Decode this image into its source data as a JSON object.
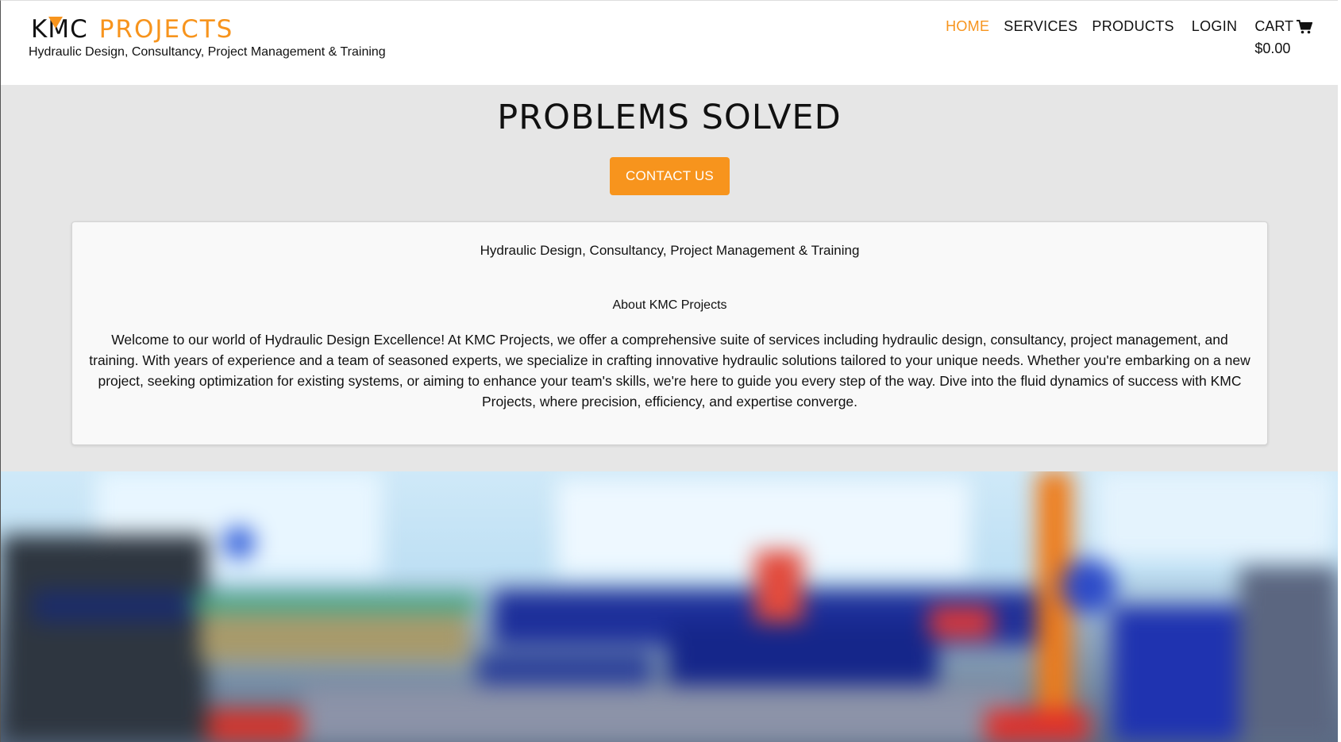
{
  "header": {
    "logo_kmc": "KMC",
    "logo_projects": "PROJECTS",
    "tagline": "Hydraulic Design, Consultancy, Project Management & Training",
    "nav": {
      "home": "HOME",
      "services": "SERVICES",
      "products": "PRODUCTS",
      "login": "LOGIN",
      "cart": "CART",
      "cart_total": "$0.00"
    }
  },
  "hero": {
    "title": "PROBLEMS SOLVED",
    "cta": "CONTACT US"
  },
  "about": {
    "subtitle": "Hydraulic Design, Consultancy, Project Management & Training",
    "heading": "About KMC Projects",
    "body": "Welcome to our world of Hydraulic Design Excellence! At KMC Projects, we offer a comprehensive suite of services including hydraulic design, consultancy, project management, and training. With years of experience and a team of seasoned experts, we specialize in crafting innovative hydraulic solutions tailored to your unique needs. Whether you're embarking on a new project, seeking optimization for existing systems, or aiming to enhance your team's skills, we're here to guide you every step of the way. Dive into the fluid dynamics of success with KMC Projects, where precision, efficiency, and expertise converge."
  },
  "colors": {
    "accent": "#f7941d",
    "page_bg": "#e6e6e6",
    "card_bg": "#f9f9f9"
  },
  "icons": {
    "cart": "shopping-cart-icon",
    "logo_mark": "orange-triangle"
  }
}
